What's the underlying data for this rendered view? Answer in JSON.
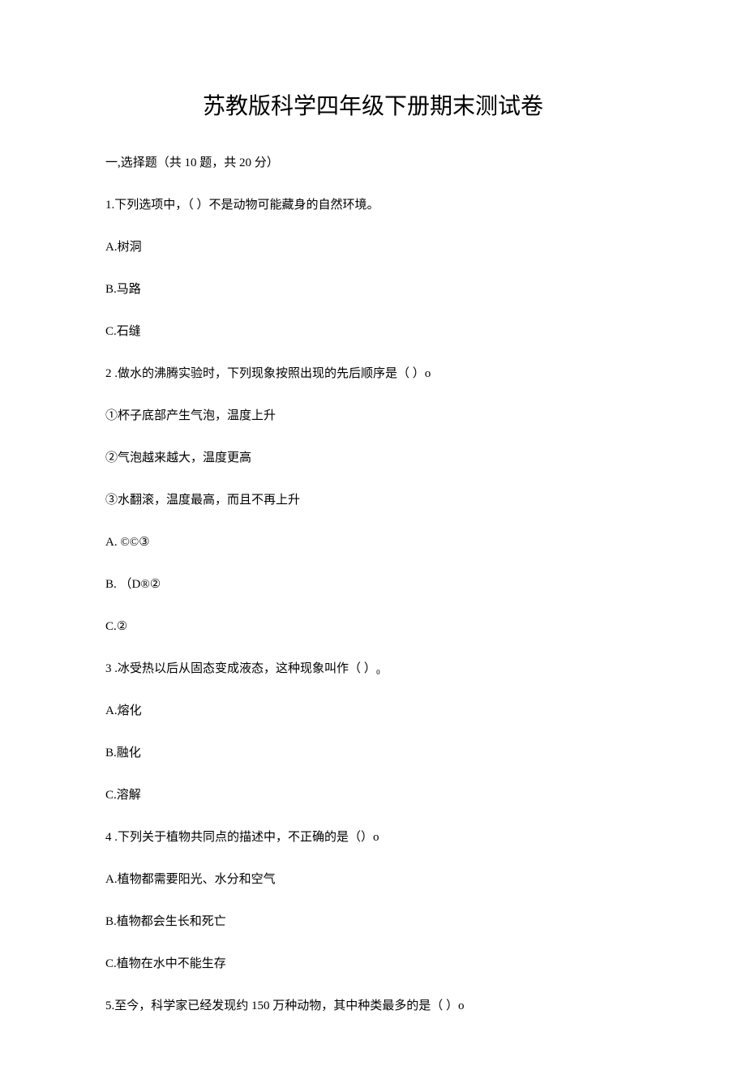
{
  "title": "苏教版科学四年级下册期末测试卷",
  "section1": {
    "header": "一,选择题（共 10 题，共 20 分）"
  },
  "q1": {
    "stem": "1.下列选项中，（        ）不是动物可能藏身的自然环境。",
    "a": "A.树洞",
    "b": "B.马路",
    "c": "C.石缝"
  },
  "q2": {
    "stem": "2   .做水的沸腾实验时，下列现象按照出现的先后顺序是（               ）o",
    "s1": "①杯子底部产生气泡，温度上升",
    "s2": "②气泡越来越大，温度更高",
    "s3": "③水翻滚，温度最高，而且不再上升",
    "a": "A.   ©©③",
    "b": "B.   （D®②",
    "c": "C.②"
  },
  "q3": {
    "stem": "3   .冰受热以后从固态变成液态，这种现象叫作（              ）₀",
    "a": "A.熔化",
    "b": "B.融化",
    "c": "C.溶解"
  },
  "q4": {
    "stem": "4   .下列关于植物共同点的描述中，不正确的是（）o",
    "a": "A.植物都需要阳光、水分和空气",
    "b": "B.植物都会生长和死亡",
    "c": "C.植物在水中不能生存"
  },
  "q5": {
    "stem": "5.至今，科学家已经发现约 150 万种动物，其中种类最多的是（               ）o"
  }
}
